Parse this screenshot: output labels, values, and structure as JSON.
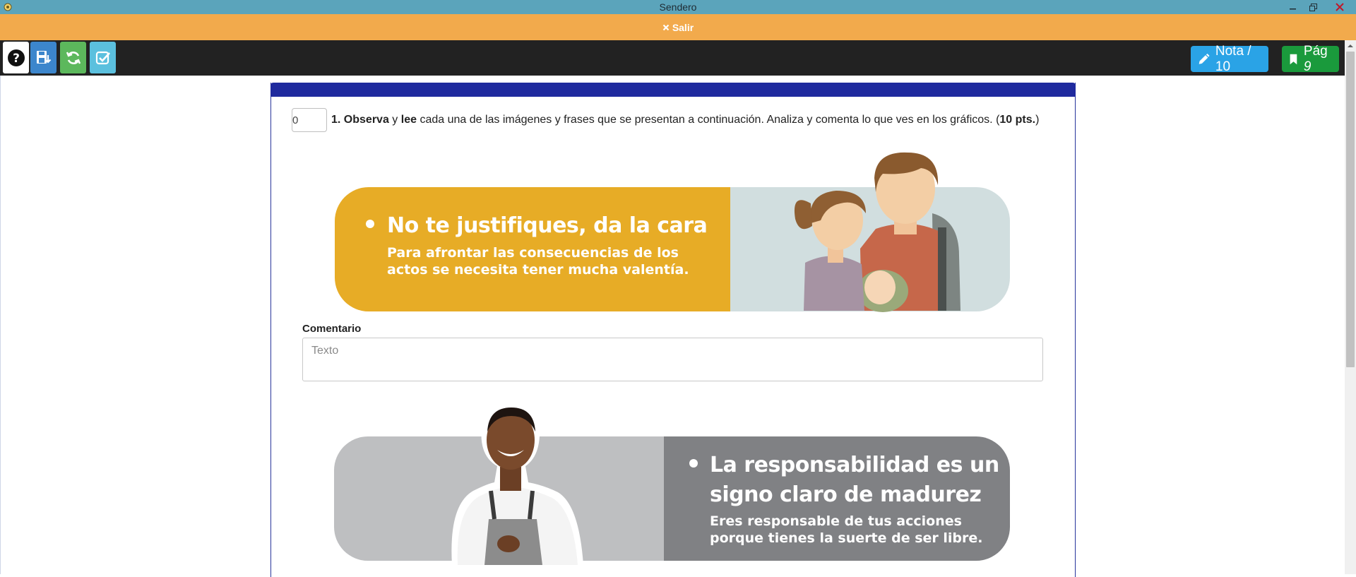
{
  "window": {
    "title": "Sendero"
  },
  "exit_bar": {
    "label": "Salir"
  },
  "toolbar": {
    "nota_label": "Nota / 10",
    "pag_label": "Pág",
    "pag_number": "9"
  },
  "question": {
    "score_value": "0",
    "number": "1.",
    "verb1": "Observa",
    "conj": "y",
    "verb2": "lee",
    "text": "cada una de las imágenes y frases que se presentan a continuación. Analiza y comenta lo que ves en los gráficos. (",
    "points": "10 pts.",
    "close": ")"
  },
  "banner1": {
    "heading": "No te justifiques, da la cara",
    "sub": "Para afrontar las consecuencias de los actos se necesita tener mucha valentía."
  },
  "comment": {
    "label": "Comentario",
    "placeholder": "Texto",
    "value": ""
  },
  "banner2": {
    "heading": "La responsabilidad es un signo claro de madurez",
    "sub": "Eres responsable de tus acciones porque tienes la suerte de ser libre."
  },
  "colors": {
    "titlebar": "#5ba4bb",
    "exitbar": "#f2aa4c",
    "toolbar": "#222222",
    "panel_header": "#1f2a9e",
    "banner1_yellow": "#e7ac26",
    "banner2_gray": "#808184"
  }
}
